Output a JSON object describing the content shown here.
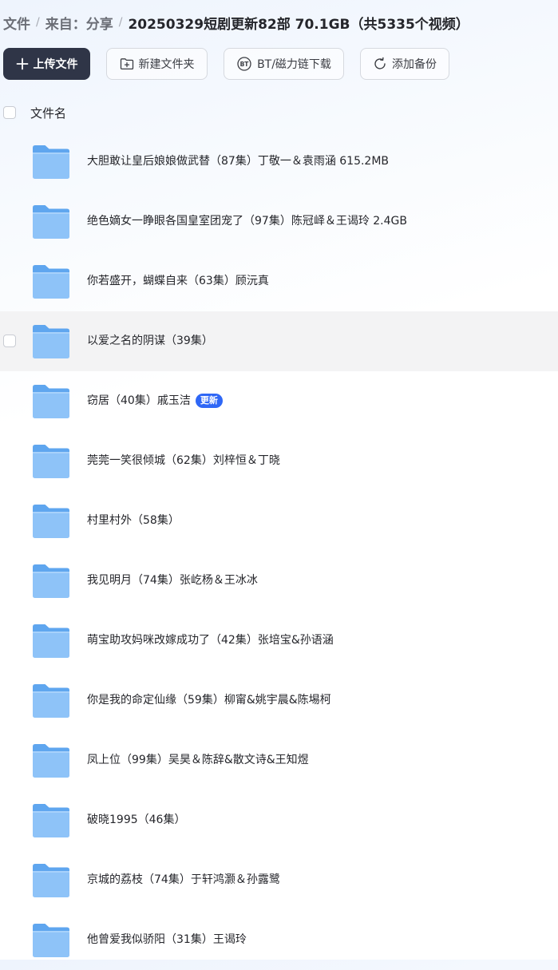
{
  "breadcrumb": {
    "items": [
      "文件",
      "来自：分享"
    ],
    "separator": "/",
    "current": "20250329短剧更新82部 70.1GB（共5335个视频）"
  },
  "toolbar": {
    "upload_label": "上传文件",
    "new_folder_label": "新建文件夹",
    "bt_label": "BT/磁力链下载",
    "backup_label": "添加备份"
  },
  "list_header": {
    "name_label": "文件名"
  },
  "files": [
    {
      "name": "大胆敢让皇后娘娘做武替（87集）丁敬一＆袁雨涵 615.2MB",
      "badge": "",
      "hovered": false
    },
    {
      "name": "绝色嫡女一睁眼各国皇室团宠了（97集）陈冠峄＆王谒玲 2.4GB",
      "badge": "",
      "hovered": false
    },
    {
      "name": "你若盛开，蝴蝶自来（63集）顾沅真",
      "badge": "",
      "hovered": false
    },
    {
      "name": "以爱之名的阴谋（39集）",
      "badge": "",
      "hovered": true
    },
    {
      "name": "窃居（40集）戚玉洁",
      "badge": "更新",
      "hovered": false
    },
    {
      "name": "莞莞一笑很倾城（62集）刘梓恒＆丁晓",
      "badge": "",
      "hovered": false
    },
    {
      "name": "村里村外（58集）",
      "badge": "",
      "hovered": false
    },
    {
      "name": "我见明月（74集）张屹杨＆王冰冰",
      "badge": "",
      "hovered": false
    },
    {
      "name": "萌宝助攻妈咪改嫁成功了（42集）张培宝&孙语涵",
      "badge": "",
      "hovered": false
    },
    {
      "name": "你是我的命定仙缘（59集）柳甯&姚宇晨&陈埸柯",
      "badge": "",
      "hovered": false
    },
    {
      "name": "凤上位（99集）吴昊＆陈辞&散文诗&王知煜",
      "badge": "",
      "hovered": false
    },
    {
      "name": "破晓1995（46集）",
      "badge": "",
      "hovered": false
    },
    {
      "name": "京城的荔枝（74集）于轩鸿灏＆孙露鹭",
      "badge": "",
      "hovered": false
    },
    {
      "name": "他曾爱我似骄阳（31集）王谒玲",
      "badge": "",
      "hovered": false
    }
  ],
  "icons": {
    "folder": "folder-icon",
    "upload": "plus-icon",
    "new_folder": "folder-plus-icon",
    "bt": "bt-icon",
    "backup": "sync-icon"
  },
  "colors": {
    "primary_button": "#2f3547",
    "badge": "#2f67f6",
    "folder": "#7fb9f6",
    "hover_row": "#f3f3f4"
  }
}
